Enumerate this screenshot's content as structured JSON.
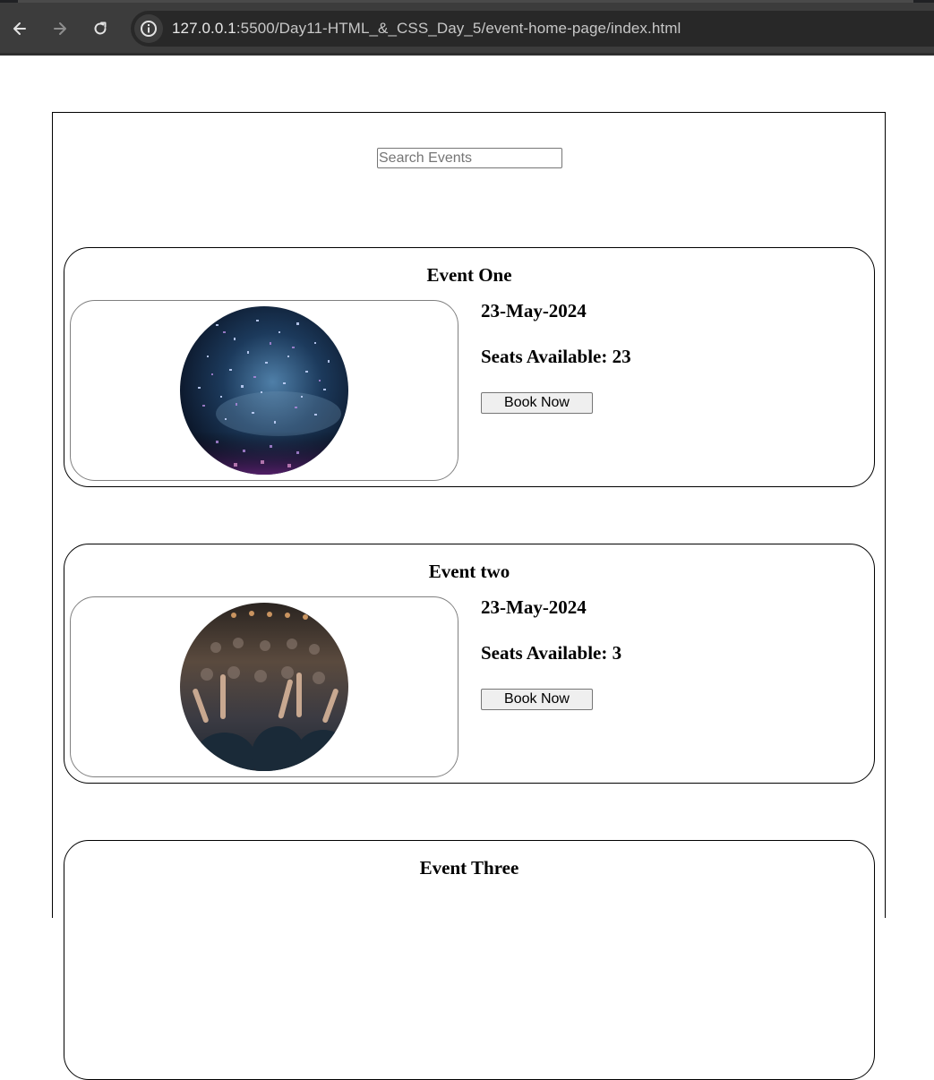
{
  "browser": {
    "url_host": "127.0.0.1",
    "url_path": ":5500/Day11-HTML_&_CSS_Day_5/event-home-page/index.html",
    "back_icon": "arrow-left-icon",
    "forward_icon": "arrow-right-icon",
    "reload_icon": "reload-icon",
    "info_icon": "info-icon"
  },
  "search": {
    "placeholder": "Search Events"
  },
  "events": [
    {
      "title": "Event One",
      "date": "23-May-2024",
      "seats": "Seats Available: 23",
      "button_label": "Book Now",
      "image": "confetti-concert-photo"
    },
    {
      "title": "Event two",
      "date": "23-May-2024",
      "seats": "Seats Available: 3",
      "button_label": "Book Now",
      "image": "crowd-hands-concert-photo"
    },
    {
      "title": "Event Three"
    }
  ],
  "colors": {
    "chrome_bg": "#3c3c3c",
    "address_bar_bg": "#282828",
    "button_bg": "#efefef",
    "border": "#000000"
  }
}
